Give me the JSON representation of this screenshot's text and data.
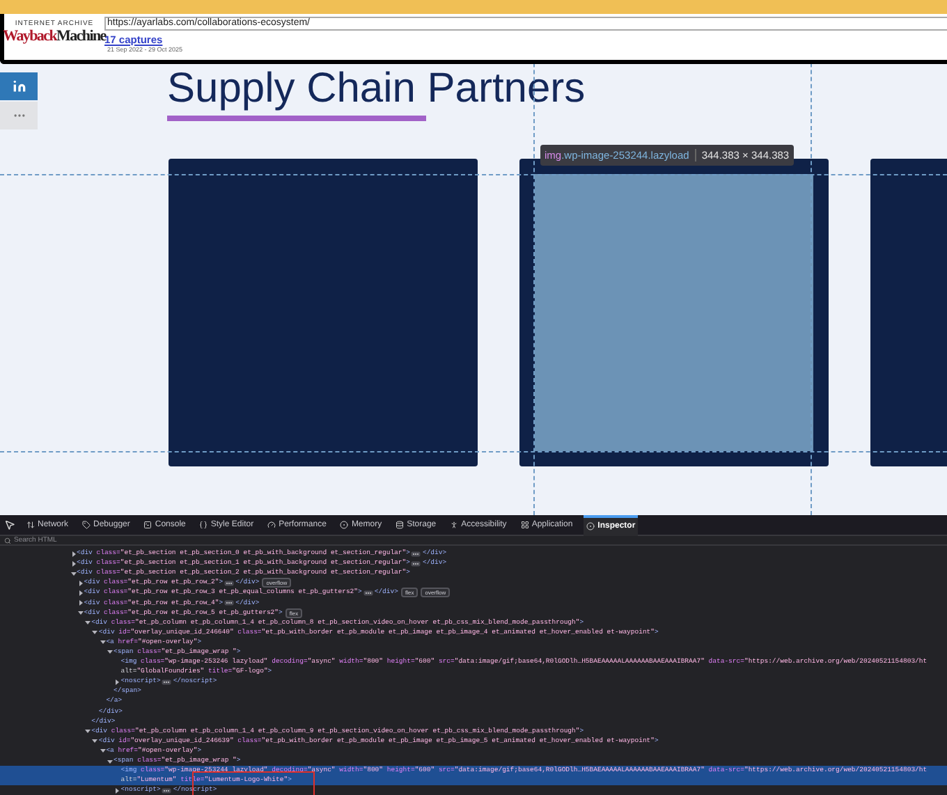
{
  "wayback": {
    "brand_top": "INTERNET ARCHIVE",
    "logo_red": "Wayback",
    "logo_black": "Machine",
    "url": "https://ayarlabs.com/collaborations-ecosystem/",
    "captures": "17 captures",
    "date_range": "21 Sep 2022 - 29 Oct 2025"
  },
  "page": {
    "title": "Supply Chain Partners",
    "cards": [
      {
        "highlighted": false
      },
      {
        "highlighted": true
      },
      {
        "highlighted": false
      }
    ]
  },
  "inspector_tooltip": {
    "tag": "img",
    "selector": ".wp-image-253244.lazyload",
    "size": "344.383 × 344.383"
  },
  "devtools": {
    "tabs": [
      {
        "label": "Network",
        "selected": false
      },
      {
        "label": "Debugger",
        "selected": false
      },
      {
        "label": "Console",
        "selected": false
      },
      {
        "label": "Style Editor",
        "selected": false
      },
      {
        "label": "Performance",
        "selected": false
      },
      {
        "label": "Memory",
        "selected": false
      },
      {
        "label": "Storage",
        "selected": false
      },
      {
        "label": "Accessibility",
        "selected": false
      },
      {
        "label": "Application",
        "selected": false
      },
      {
        "label": "Inspector",
        "selected": true
      }
    ],
    "search": {
      "placeholder": "Search HTML"
    },
    "tree": [
      {
        "text": "<div class=\"et_pb_section et_pb_section_0 et_pb_with_background et_section_regular\">",
        "expanded": false,
        "inline_close": "</div>",
        "selected": false
      },
      {
        "text": "<div class=\"et_pb_section et_pb_section_1 et_pb_with_background et_section_regular\">",
        "expanded": false,
        "inline_close": "</div>",
        "selected": false
      },
      {
        "text": "<div class=\"et_pb_section et_pb_section_2 et_pb_with_background et_section_regular\">",
        "expanded": true,
        "selected": false,
        "children": [
          {
            "text": "<div class=\"et_pb_row et_pb_row_2\">",
            "expanded": false,
            "inline_close": "</div>",
            "badges": [
              "overflow"
            ],
            "selected": false
          },
          {
            "text": "<div class=\"et_pb_row et_pb_row_3 et_pb_equal_columns et_pb_gutters2\">",
            "expanded": false,
            "inline_close": "</div>",
            "badges": [
              "flex",
              "overflow"
            ],
            "selected": false
          },
          {
            "text": "<div class=\"et_pb_row et_pb_row_4\">",
            "expanded": false,
            "inline_close": "</div>",
            "selected": false
          },
          {
            "text": "<div class=\"et_pb_row et_pb_row_5 et_pb_gutters2\">",
            "expanded": true,
            "badges": [
              "flex"
            ],
            "selected": false,
            "children": [
              {
                "text": "<div class=\"et_pb_column et_pb_column_1_4 et_pb_column_8 et_pb_section_video_on_hover et_pb_css_mix_blend_mode_passthrough\">",
                "expanded": true,
                "selected": false,
                "close": "</div>",
                "children": [
                  {
                    "text": "<div id=\"overlay_unique_id_246640\" class=\"et_pb_with_border et_pb_module et_pb_image et_pb_image_4 et_animated et_hover_enabled et-waypoint\">",
                    "expanded": true,
                    "selected": false,
                    "close": "</div>",
                    "children": [
                      {
                        "text": "<a href=\"#open-overlay\">",
                        "expanded": true,
                        "selected": false,
                        "close": "</a>",
                        "children": [
                          {
                            "text": "<span class=\"et_pb_image_wrap \">",
                            "expanded": true,
                            "selected": false,
                            "close": "</span>",
                            "children": [
                              {
                                "text": "<img class=\"wp-image-253246 lazyload\" decoding=\"async\" width=\"800\" height=\"600\" src=\"data:image/gif;base64,R0lGODlh…H5BAEAAAAALAAAAAABAAEAAAIBRAA7\" data-src=\"https://web.archive.org/web/20240521154803/ht",
                                "text_2": "alt=\"GlobalFoundries\" title=\"GF-logo\">",
                                "selected": false
                              },
                              {
                                "text": "<noscript>",
                                "expanded": false,
                                "inline_close": "</noscript>",
                                "selected": false
                              }
                            ]
                          }
                        ]
                      }
                    ]
                  }
                ]
              },
              {
                "text": "<div class=\"et_pb_column et_pb_column_1_4 et_pb_column_9 et_pb_section_video_on_hover et_pb_css_mix_blend_mode_passthrough\">",
                "expanded": true,
                "selected": false,
                "children": [
                  {
                    "text": "<div id=\"overlay_unique_id_246639\" class=\"et_pb_with_border et_pb_module et_pb_image et_pb_image_5 et_animated et_hover_enabled et-waypoint\">",
                    "expanded": true,
                    "selected": false,
                    "children": [
                      {
                        "text": "<a href=\"#open-overlay\">",
                        "expanded": true,
                        "selected": false,
                        "children": [
                          {
                            "text": "<span class=\"et_pb_image_wrap \">",
                            "expanded": true,
                            "selected": false,
                            "children": [
                              {
                                "text": "<img class=\"wp-image-253244 lazyload\" decoding=\"async\" width=\"800\" height=\"600\" src=\"data:image/gif;base64,R0lGODlh…H5BAEAAAAALAAAAAABAAEAAAIBRAA7\" data-src=\"https://web.archive.org/web/20240521154803/ht",
                                "text_2": "alt=\"Lumentum\" title=\"Lumentum-Logo-White\">",
                                "selected": true
                              },
                              {
                                "text": "<noscript>",
                                "expanded": false,
                                "inline_close": "</noscript>",
                                "selected": false
                              }
                            ]
                          }
                        ]
                      }
                    ]
                  }
                ]
              }
            ]
          }
        ]
      }
    ]
  }
}
